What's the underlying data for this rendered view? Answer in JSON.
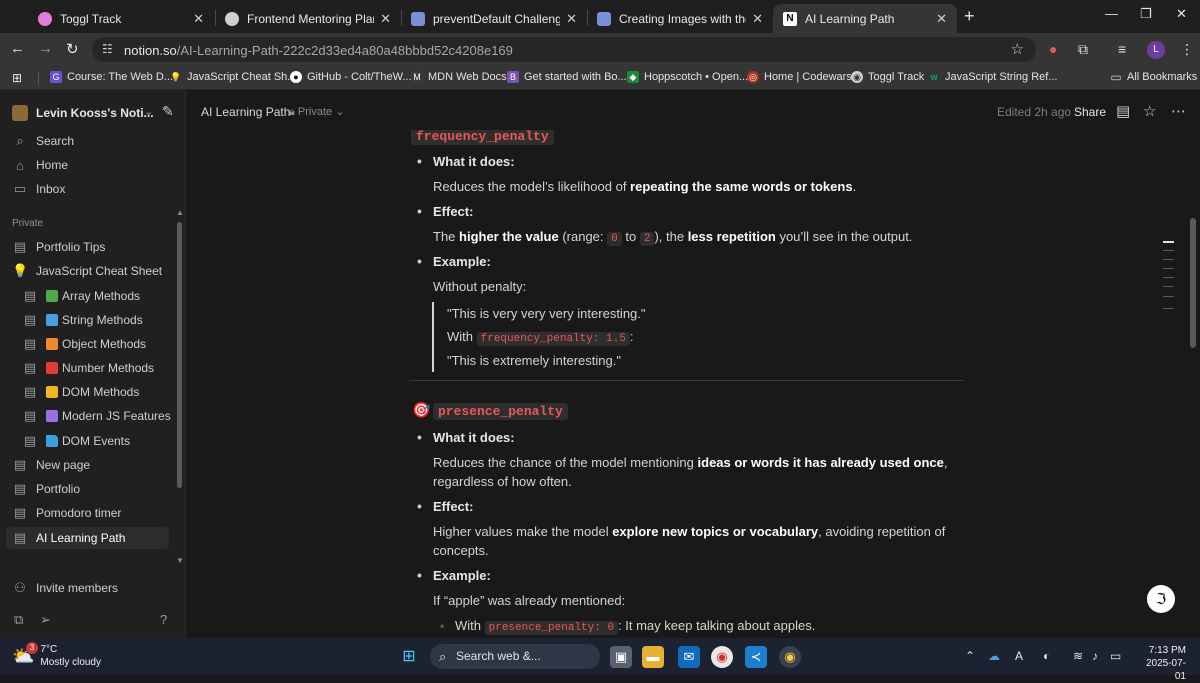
{
  "browser": {
    "tabs": [
      {
        "title": "Toggl Track",
        "color": "#e57cd8"
      },
      {
        "title": "Frontend Mentoring Plan",
        "color": "#cfcfcf"
      },
      {
        "title": "preventDefault Challenge",
        "color": "#7a8fd6"
      },
      {
        "title": "Creating Images with the DALL·E",
        "color": "#7a8fd6"
      },
      {
        "title": "AI Learning Path",
        "color": "#ffffff"
      }
    ],
    "url_host": "notion.so",
    "url_path": "/AI-Learning-Path-222c2d33ed4a80a48bbbd52c4208e169",
    "profile_initial": "L",
    "bookmarks": [
      {
        "label": "Course: The Web D...",
        "color": "#6b4fd6",
        "glyph": "G"
      },
      {
        "label": "JavaScript Cheat Sh...",
        "color": "#f0c040",
        "glyph": "💡"
      },
      {
        "label": "GitHub - Colt/TheW...",
        "color": "#ffffff",
        "glyph": "●"
      },
      {
        "label": "MDN Web Docs",
        "color": "#3a3a3a",
        "glyph": "M"
      },
      {
        "label": "Get started with Bo...",
        "color": "#7952b3",
        "glyph": "B"
      },
      {
        "label": "Hoppscotch • Open...",
        "color": "#1b8a3c",
        "glyph": "◆"
      },
      {
        "label": "Home | Codewars",
        "color": "#b1361e",
        "glyph": "◎"
      },
      {
        "label": "Toggl Track",
        "color": "#cfcfcf",
        "glyph": "◉"
      },
      {
        "label": "JavaScript String Ref...",
        "color": "#04aa6d",
        "glyph": "w"
      }
    ],
    "all_bookmarks": "All Bookmarks"
  },
  "sidebar": {
    "workspace": "Levin Kooss's Noti...",
    "top": [
      {
        "label": "Search",
        "icon": "search-icon",
        "glyph": "⌕"
      },
      {
        "label": "Home",
        "icon": "home-icon",
        "glyph": "⌂"
      },
      {
        "label": "Inbox",
        "icon": "inbox-icon",
        "glyph": "▭"
      }
    ],
    "section_label": "Private",
    "pages": [
      {
        "label": "Portfolio Tips",
        "indent": 0,
        "square": ""
      },
      {
        "label": "JavaScript Cheat Sheet",
        "indent": 0,
        "square": "",
        "bulb": true
      },
      {
        "label": "Array Methods",
        "indent": 1,
        "square": "#4dab4d"
      },
      {
        "label": "String Methods",
        "indent": 1,
        "square": "#4a9fe0"
      },
      {
        "label": "Object Methods",
        "indent": 1,
        "square": "#f0892b"
      },
      {
        "label": "Number Methods",
        "indent": 1,
        "square": "#e03e3e"
      },
      {
        "label": "DOM Methods",
        "indent": 1,
        "square": "#f0b429"
      },
      {
        "label": "Modern JS Features",
        "indent": 1,
        "square": "#9d6fe0"
      },
      {
        "label": "DOM Events",
        "indent": 1,
        "square": "#3e9fe0",
        "folder": true
      },
      {
        "label": "New page",
        "indent": 0,
        "square": ""
      },
      {
        "label": "Portfolio",
        "indent": 0,
        "square": ""
      },
      {
        "label": "Pomodoro timer",
        "indent": 0,
        "square": ""
      },
      {
        "label": "AI Learning Path",
        "indent": 0,
        "square": "",
        "active": true
      }
    ],
    "invite": "Invite members"
  },
  "topbar": {
    "breadcrumb": "AI Learning Path",
    "privacy": "Private",
    "edited": "Edited 2h ago",
    "share": "Share"
  },
  "doc": {
    "s1_heading": "frequency_penalty",
    "what_label": "What it does:",
    "s1_what_pre": "Reduces the model’s likelihood of ",
    "s1_what_bold": "repeating the same words or tokens",
    "s1_what_post": ".",
    "effect_label": "Effect:",
    "s1_eff_pre": "The ",
    "s1_eff_b1": "higher the value",
    "s1_eff_mid1": " (range: ",
    "s1_eff_c1": "0",
    "s1_eff_to": " to ",
    "s1_eff_c2": "2",
    "s1_eff_mid2": "), the ",
    "s1_eff_b2": "less repetition",
    "s1_eff_post": " you’ll see in the output.",
    "example_label": "Example:",
    "s1_without": "Without penalty:",
    "s1_q1": "\"This is very very very interesting.\"",
    "s1_with": "With ",
    "s1_with_code": "frequency_penalty: 1.5",
    "s1_with_colon": ":",
    "s1_q2": "\"This is extremely interesting.\"",
    "s2_heading": "presence_penalty",
    "s2_what_pre": "Reduces the chance of the model mentioning ",
    "s2_what_bold": "ideas or words it has already used once",
    "s2_what_post": ",",
    "s2_what_line2": "regardless of how often.",
    "s2_eff_pre": "Higher values make the model ",
    "s2_eff_bold": "explore new topics or vocabulary",
    "s2_eff_post": ", avoiding repetition of",
    "s2_eff_line2": "concepts.",
    "s2_if": "If “apple” was already mentioned:",
    "s2_with": "With ",
    "s2_with_code": "presence_penalty: 0",
    "s2_with_post": ": It may keep talking about apples."
  },
  "taskbar": {
    "weather_badge": "3",
    "temp": "7°C",
    "condition": "Mostly cloudy",
    "search": "Search web &...",
    "time": "7:13 PM",
    "date": "2025-07-01"
  }
}
